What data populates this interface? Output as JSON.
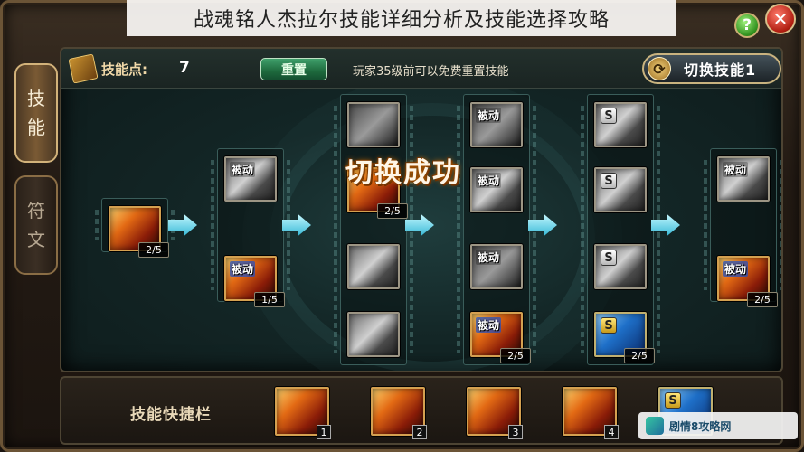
{
  "caption": "战魂铭人杰拉尔技能详细分析及技能选择攻略",
  "window": {
    "help_label": "?",
    "close_label": "✕"
  },
  "side_tabs": [
    {
      "chars": [
        "技",
        "能"
      ],
      "active": true
    },
    {
      "chars": [
        "符",
        "文"
      ],
      "active": false
    }
  ],
  "topbar": {
    "skill_points_label": "技能点:",
    "skill_points_value": "7",
    "reset_label": "重置",
    "reset_hint": "玩家35级前可以免费重置技能",
    "switch_label": "切换技能1",
    "switch_icon": "cycle-arrows-icon"
  },
  "overlay_text": "切换成功",
  "skill_tree": {
    "columns": [
      {
        "skills": [
          {
            "style": "fire",
            "badge": "",
            "level": "2/5"
          }
        ]
      },
      {
        "skills": [
          {
            "style": "gray",
            "badge": "被动",
            "level": ""
          },
          {
            "style": "fire",
            "badge": "被动",
            "level": "1/5"
          }
        ]
      },
      {
        "skills": [
          {
            "style": "dark",
            "badge": "",
            "level": ""
          },
          {
            "style": "fire",
            "badge": "",
            "level": "2/5"
          },
          {
            "style": "gray",
            "badge": "",
            "level": ""
          },
          {
            "style": "gray",
            "badge": "",
            "level": ""
          }
        ]
      },
      {
        "skills": [
          {
            "style": "dark",
            "badge": "被动",
            "level": ""
          },
          {
            "style": "gray",
            "badge": "被动",
            "level": ""
          },
          {
            "style": "dark",
            "badge": "被动",
            "level": ""
          },
          {
            "style": "fire",
            "badge": "被动",
            "level": "2/5"
          }
        ]
      },
      {
        "skills": [
          {
            "style": "gray",
            "badge": "S",
            "level": ""
          },
          {
            "style": "gray",
            "badge": "S",
            "level": ""
          },
          {
            "style": "gray",
            "badge": "S",
            "level": ""
          },
          {
            "style": "blue",
            "badge": "S",
            "level": "2/5"
          }
        ]
      },
      {
        "skills": [
          {
            "style": "gray",
            "badge": "被动",
            "level": ""
          },
          {
            "style": "fire",
            "badge": "被动",
            "level": "2/5"
          }
        ]
      }
    ]
  },
  "quickbar": {
    "label": "技能快捷栏",
    "slots": [
      {
        "style": "fire",
        "badge": "",
        "num": "1"
      },
      {
        "style": "fire",
        "badge": "",
        "num": "2"
      },
      {
        "style": "fire",
        "badge": "",
        "num": "3"
      },
      {
        "style": "fire",
        "badge": "",
        "num": "4"
      },
      {
        "style": "blue",
        "badge": "S",
        "num": ""
      }
    ]
  },
  "watermark": {
    "text": "剧情8攻略网"
  }
}
